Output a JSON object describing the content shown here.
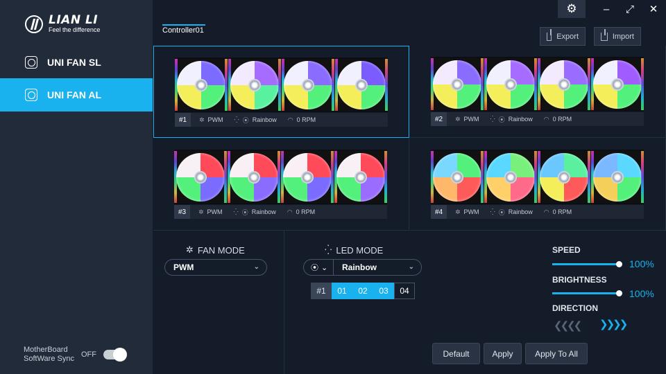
{
  "brand": {
    "name": "LIAN LI",
    "tagline": "Feel the difference"
  },
  "sidebar": {
    "items": [
      {
        "label": "UNI FAN SL",
        "active": false
      },
      {
        "label": "UNI FAN AL",
        "active": true
      }
    ],
    "sync": {
      "line1": "MotherBoard",
      "line2": "SoftWare Sync",
      "state": "OFF"
    }
  },
  "window": {
    "settings_icon": "gear-icon",
    "minimize": "–",
    "maximize": "⤢",
    "close": "✕"
  },
  "controller_tab": "Controller01",
  "actions": {
    "export": "Export",
    "import": "Import"
  },
  "groups": [
    {
      "num": "#1",
      "fan_mode": "PWM",
      "led_mode": "Rainbow",
      "rpm": "0 RPM"
    },
    {
      "num": "#2",
      "fan_mode": "PWM",
      "led_mode": "Rainbow",
      "rpm": "0 RPM"
    },
    {
      "num": "#3",
      "fan_mode": "PWM",
      "led_mode": "Rainbow",
      "rpm": "0 RPM"
    },
    {
      "num": "#4",
      "fan_mode": "PWM",
      "led_mode": "Rainbow",
      "rpm": "0 RPM"
    }
  ],
  "fan_mode": {
    "title": "FAN MODE",
    "value": "PWM"
  },
  "led_mode": {
    "title": "LED MODE",
    "value": "Rainbow"
  },
  "fan_tabs": {
    "head": "#1",
    "tabs": [
      "01",
      "02",
      "03",
      "04"
    ],
    "selected": [
      true,
      true,
      true,
      false
    ]
  },
  "speed": {
    "label": "SPEED",
    "value": "100%",
    "level": 1.0
  },
  "brightness": {
    "label": "BRIGHTNESS",
    "value": "100%",
    "level": 1.0
  },
  "direction": {
    "label": "DIRECTION"
  },
  "buttons": {
    "default": "Default",
    "apply": "Apply",
    "apply_all": "Apply To All"
  },
  "colors": {
    "accent": "#1ab2ee",
    "sidebar": "#222b3a",
    "background": "#141b29"
  }
}
